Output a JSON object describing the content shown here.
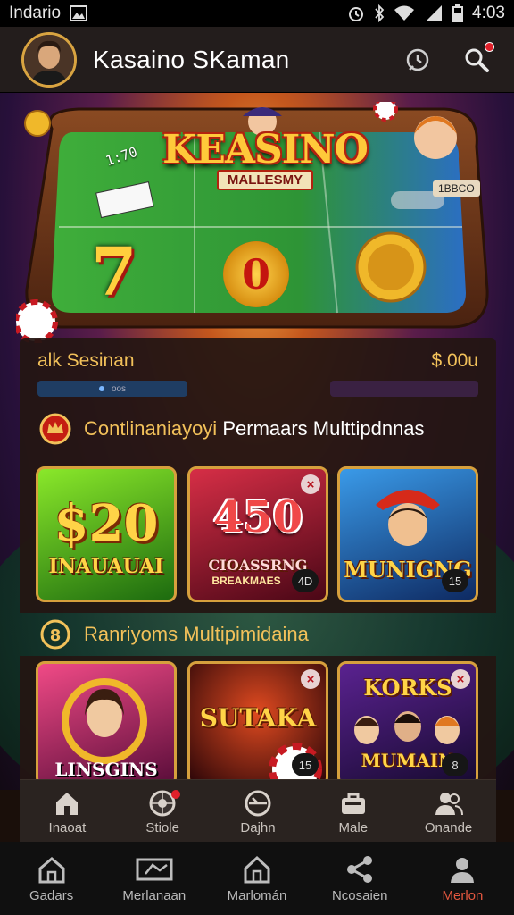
{
  "status_bar": {
    "carrier": "Indario",
    "time": "4:03"
  },
  "header": {
    "title": "Kasaino SKaman"
  },
  "hero": {
    "logo_main": "KEASINO",
    "logo_sub": "MALLESMY",
    "plate": "1BBCO",
    "odds": "1:70",
    "seven": "7",
    "zero": "0"
  },
  "session": {
    "label": "alk Sesinan",
    "amount": "$.00u",
    "bar1_text": "oos",
    "bar2_text": "",
    "bar3_text": ""
  },
  "sections": [
    {
      "title_gold": "Contlinaniayoyi",
      "title_white": "Permaars Multtipdnnas",
      "cards": [
        {
          "big": "$20",
          "title": "INAUAUAI",
          "sub": "",
          "count": "",
          "colors": [
            "#7ad81f",
            "#1d6b0f"
          ]
        },
        {
          "big": "450",
          "title": "CIOASSRNG",
          "sub": "BREAKMAES",
          "count": "4D",
          "colors": [
            "#c0243a",
            "#4a0716"
          ]
        },
        {
          "big": "",
          "title": "MUNIGNG",
          "sub": "",
          "count": "15",
          "colors": [
            "#2a88d8",
            "#0e2a62"
          ]
        }
      ]
    },
    {
      "title_gold": "Ranriyoms",
      "title_white": "Multipimidaina",
      "cards": [
        {
          "big": "",
          "title": "LINSGINS",
          "sub": "",
          "count": "",
          "colors": [
            "#e0356e",
            "#5a0d3a"
          ]
        },
        {
          "big": "",
          "title": "SUTAKA",
          "sub": "",
          "count": "15",
          "colors": [
            "#8a0f1e",
            "#2a0508"
          ]
        },
        {
          "big": "",
          "title": "KORKS",
          "sub": "MUMAIN",
          "count": "8",
          "colors": [
            "#4a1b7a",
            "#170a30"
          ]
        }
      ]
    }
  ],
  "tabs_upper": [
    {
      "label": "Inaoat",
      "icon": "home-icon",
      "badge": false
    },
    {
      "label": "Stiole",
      "icon": "roulette-icon",
      "badge": true
    },
    {
      "label": "Dajhn",
      "icon": "compass-icon",
      "badge": false
    },
    {
      "label": "Male",
      "icon": "bag-icon",
      "badge": false
    },
    {
      "label": "Onande",
      "icon": "users-icon",
      "badge": false
    }
  ],
  "tabs_lower": [
    {
      "label": "Gadars",
      "icon": "home-icon",
      "active": false
    },
    {
      "label": "Merlanaan",
      "icon": "ticket-icon",
      "active": false
    },
    {
      "label": "Marlomán",
      "icon": "house-icon",
      "active": false
    },
    {
      "label": "Ncosaien",
      "icon": "share-icon",
      "active": false
    },
    {
      "label": "Merlon",
      "icon": "user-icon",
      "active": true
    }
  ],
  "colors": {
    "accent_gold": "#f2c15a",
    "card_border": "#d6a03d",
    "active_tab": "#e3573f"
  }
}
